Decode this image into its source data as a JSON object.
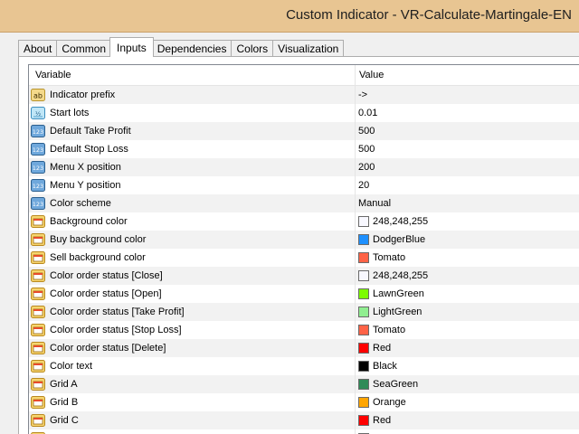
{
  "window": {
    "title": "Custom Indicator - VR-Calculate-Martingale-EN"
  },
  "tabs": [
    {
      "label": "About",
      "active": false
    },
    {
      "label": "Common",
      "active": false
    },
    {
      "label": "Inputs",
      "active": true
    },
    {
      "label": "Dependencies",
      "active": false
    },
    {
      "label": "Colors",
      "active": false
    },
    {
      "label": "Visualization",
      "active": false
    }
  ],
  "grid": {
    "columns": {
      "variable": "Variable",
      "value": "Value"
    },
    "rows": [
      {
        "type": "string",
        "icon": "string-type-icon",
        "variable": "Indicator prefix",
        "value": "->"
      },
      {
        "type": "double",
        "icon": "double-type-icon",
        "variable": "Start lots",
        "value": "0.01"
      },
      {
        "type": "int",
        "icon": "integer-type-icon",
        "variable": "Default Take Profit",
        "value": "500"
      },
      {
        "type": "int",
        "icon": "integer-type-icon",
        "variable": "Default Stop Loss",
        "value": "500"
      },
      {
        "type": "int",
        "icon": "integer-type-icon",
        "variable": "Menu X position",
        "value": "200"
      },
      {
        "type": "int",
        "icon": "integer-type-icon",
        "variable": "Menu Y position",
        "value": "20"
      },
      {
        "type": "enum",
        "icon": "integer-type-icon",
        "variable": "Color scheme",
        "value": "Manual"
      },
      {
        "type": "color",
        "icon": "color-type-icon",
        "variable": "Background color",
        "value": "248,248,255",
        "swatch": "#f8f8ff"
      },
      {
        "type": "color",
        "icon": "color-type-icon",
        "variable": "Buy background color",
        "value": "DodgerBlue",
        "swatch": "#1e90ff"
      },
      {
        "type": "color",
        "icon": "color-type-icon",
        "variable": "Sell background color",
        "value": "Tomato",
        "swatch": "#ff6347"
      },
      {
        "type": "color",
        "icon": "color-type-icon",
        "variable": "Color order status [Close]",
        "value": "248,248,255",
        "swatch": "#f8f8ff"
      },
      {
        "type": "color",
        "icon": "color-type-icon",
        "variable": "Color order status [Open]",
        "value": "LawnGreen",
        "swatch": "#7cfc00"
      },
      {
        "type": "color",
        "icon": "color-type-icon",
        "variable": "Color order status [Take Profit]",
        "value": "LightGreen",
        "swatch": "#90ee90"
      },
      {
        "type": "color",
        "icon": "color-type-icon",
        "variable": "Color order status [Stop Loss]",
        "value": "Tomato",
        "swatch": "#ff6347"
      },
      {
        "type": "color",
        "icon": "color-type-icon",
        "variable": "Color order status [Delete]",
        "value": "Red",
        "swatch": "#ff0000"
      },
      {
        "type": "color",
        "icon": "color-type-icon",
        "variable": "Color text",
        "value": "Black",
        "swatch": "#000000"
      },
      {
        "type": "color",
        "icon": "color-type-icon",
        "variable": "Grid A",
        "value": "SeaGreen",
        "swatch": "#2e8b57"
      },
      {
        "type": "color",
        "icon": "color-type-icon",
        "variable": "Grid B",
        "value": "Orange",
        "swatch": "#ffa500"
      },
      {
        "type": "color",
        "icon": "color-type-icon",
        "variable": "Grid C",
        "value": "Red",
        "swatch": "#ff0000"
      },
      {
        "type": "color",
        "icon": "color-type-icon",
        "variable": "",
        "value": "",
        "swatch": "#d0d0d0"
      }
    ]
  }
}
